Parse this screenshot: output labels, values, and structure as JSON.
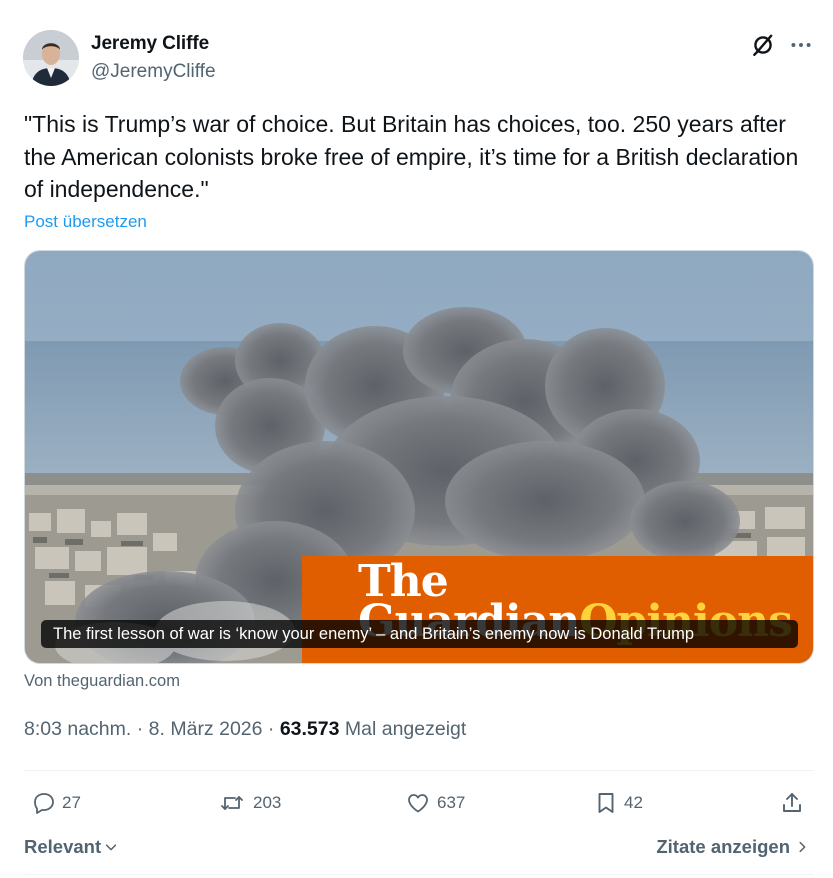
{
  "author": {
    "name": "Jeremy Cliffe",
    "handle": "@JeremyCliffe"
  },
  "post": {
    "text": "\"This is Trump’s war of choice. But Britain has choices, too. 250 years after the American colonists broke free of empire, it’s time for a British declaration of independence.\"",
    "translate_label": "Post übersetzen"
  },
  "card": {
    "brand_line1": "The",
    "brand_line2": "Guardian",
    "brand_section": "Opinions",
    "caption": "The first lesson of war is ‘know your enemy’ – and Britain’s enemy now is Donald Trump",
    "source": "Von theguardian.com"
  },
  "meta": {
    "time": "8:03 nachm.",
    "date": "8. März 2026",
    "views_count": "63.573",
    "views_label": "Mal angezeigt",
    "separator": "·"
  },
  "actions": {
    "replies": "27",
    "reposts": "203",
    "likes": "637",
    "bookmarks": "42"
  },
  "footer": {
    "sort_label": "Relevant",
    "quotes_label": "Zitate anzeigen"
  },
  "icons": {
    "header": [
      "grok-icon",
      "more-icon"
    ],
    "actions": [
      "reply-icon",
      "repost-icon",
      "like-icon",
      "bookmark-icon",
      "share-icon"
    ]
  },
  "colors": {
    "text_primary": "#0f1419",
    "text_secondary": "#536471",
    "link": "#1d9bf0",
    "guardian_orange": "#e05e00",
    "divider": "#eff3f4"
  }
}
